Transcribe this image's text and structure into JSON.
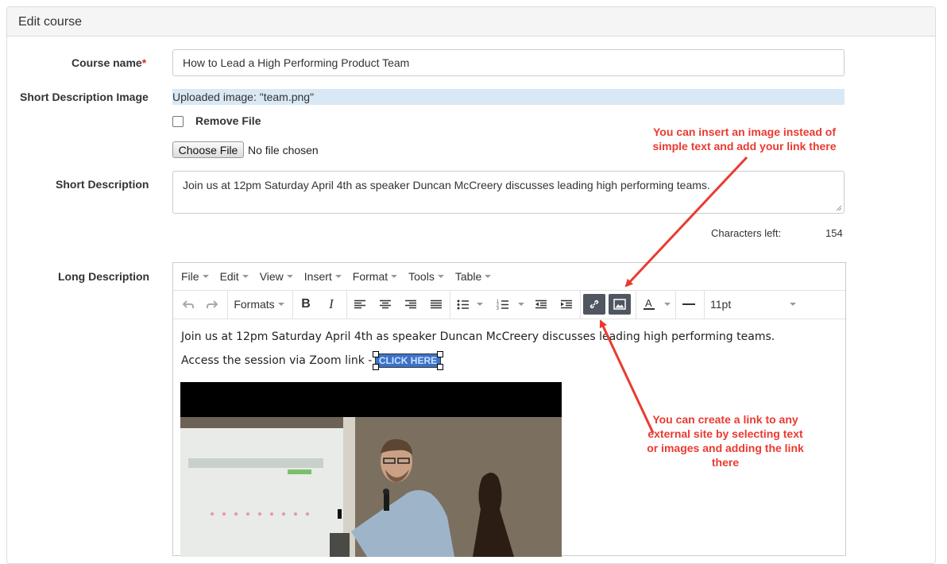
{
  "panel": {
    "title": "Edit course"
  },
  "form": {
    "course_name_label": "Course name",
    "required_mark": "*",
    "course_name_value": "How to Lead a High Performing Product Team",
    "short_desc_image_label": "Short Description Image",
    "uploaded_image_text": "Uploaded image: \"team.png\"",
    "remove_file_label": "Remove File",
    "choose_file_label": "Choose File",
    "no_file_text": "No file chosen",
    "short_desc_label": "Short Description",
    "short_desc_value": "Join us at 12pm Saturday April 4th as speaker Duncan McCreery discusses leading high performing teams.",
    "chars_left_label": "Characters left:",
    "chars_left_value": "154",
    "long_desc_label": "Long Description"
  },
  "editor": {
    "menu": [
      "File",
      "Edit",
      "View",
      "Insert",
      "Format",
      "Tools",
      "Table"
    ],
    "formats_label": "Formats",
    "font_size": "11pt",
    "content_line1": "Join us at 12pm Saturday April 4th as speaker Duncan McCreery discusses leading high performing teams.",
    "content_line2": "Access the session via Zoom link -",
    "click_here": "CLICK HERE"
  },
  "annotations": {
    "image_note": "You can insert an image instead of simple text and add your link there",
    "link_note": "You can create a link to any external site by selecting text or images and adding the link there"
  },
  "colors": {
    "annotation": "#ea3a30",
    "active_button": "#4f5660",
    "highlight": "#d9e8f5"
  }
}
